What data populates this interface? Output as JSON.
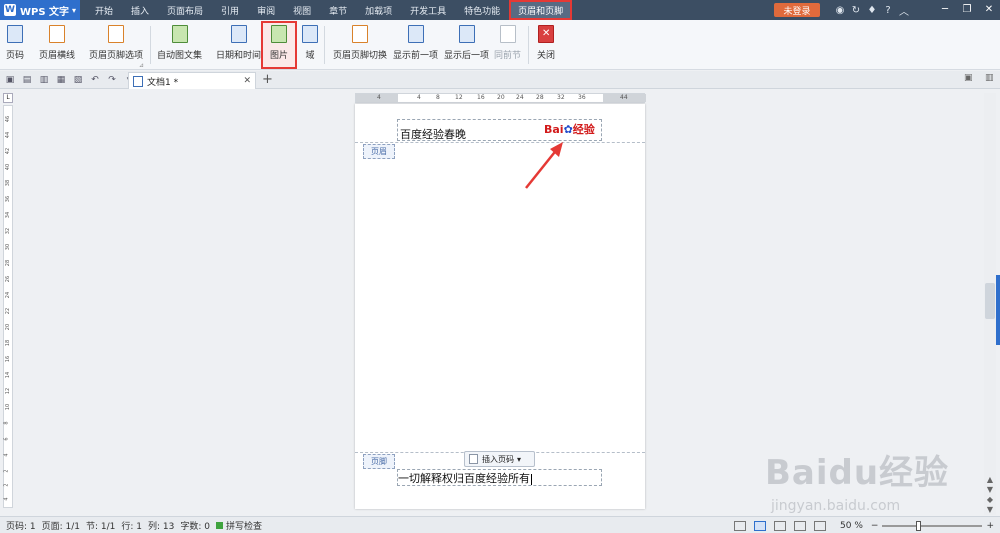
{
  "titlebar": {
    "app_name": "WPS 文字",
    "tabs": [
      "开始",
      "插入",
      "页面布局",
      "引用",
      "审阅",
      "视图",
      "章节",
      "加载项",
      "开发工具",
      "特色功能",
      "页眉和页脚"
    ],
    "login": "未登录",
    "help": "?"
  },
  "ribbon": {
    "page_num": "页码",
    "header_line": "页眉横线",
    "header_footer_options": "页眉页脚选项",
    "auto_text": "自动图文集",
    "date_time": "日期和时间",
    "picture": "图片",
    "field": "域",
    "switch": "页眉页脚切换",
    "show_prev": "显示前一项",
    "show_next": "显示后一项",
    "same_as_prev": "同前节",
    "close": "关闭"
  },
  "tabs": {
    "document": "文档1 *"
  },
  "ruler": {
    "h_ticks": [
      "4",
      "4",
      "8",
      "12",
      "16",
      "20",
      "24",
      "28",
      "32",
      "36",
      "44"
    ],
    "v_ticks": [
      "46",
      "44",
      "42",
      "40",
      "38",
      "36",
      "34",
      "32",
      "30",
      "28",
      "26",
      "24",
      "22",
      "20",
      "18",
      "16",
      "14",
      "12",
      "10",
      "8",
      "6",
      "4",
      "2",
      "2",
      "4"
    ]
  },
  "page": {
    "header_text": "百度经验春晚",
    "header_logo_text": "Bai",
    "header_logo_cn": "经验",
    "header_label": "页眉",
    "footer_label": "页脚",
    "insert_page_num": "插入页码",
    "footer_text": "一切解释权归百度经验所有"
  },
  "status": {
    "page_num": "页码: 1",
    "pages": "页面: 1/1",
    "section": "节: 1/1",
    "row": "行: 1",
    "col": "列: 13",
    "word_count": "字数: 0",
    "spell_check": "拼写检查",
    "zoom": "50 %"
  },
  "watermark": {
    "brand": "Baidu经验",
    "url": "jingyan.baidu.com"
  }
}
